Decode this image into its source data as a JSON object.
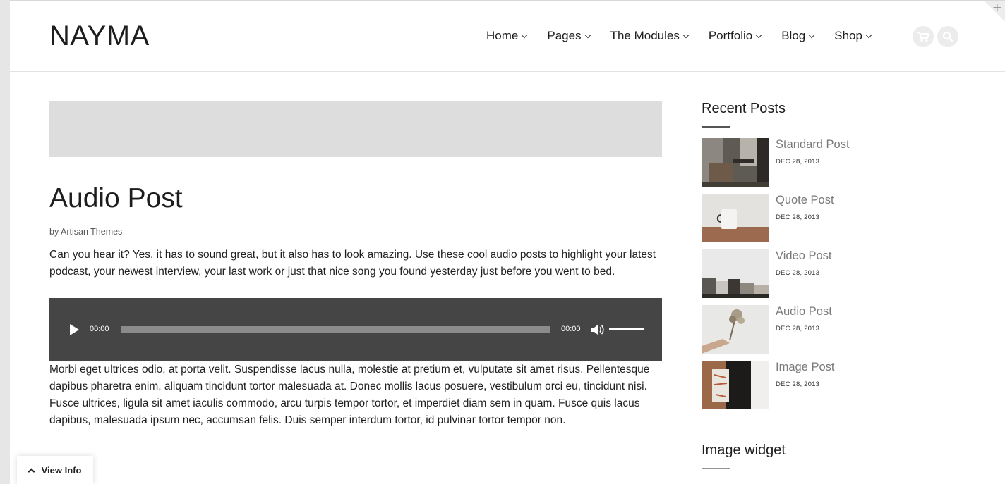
{
  "header": {
    "logo": "NAYMA",
    "nav": [
      {
        "label": "Home"
      },
      {
        "label": "Pages"
      },
      {
        "label": "The Modules"
      },
      {
        "label": "Portfolio"
      },
      {
        "label": "Blog"
      },
      {
        "label": "Shop"
      }
    ],
    "icons": [
      "cart-icon",
      "search-icon"
    ]
  },
  "post": {
    "title": "Audio Post",
    "byline_prefix": "by",
    "author": "Artisan Themes",
    "intro": "Can you hear it? Yes, it has to sound great, but it also has to look amazing. Use these cool audio posts to highlight your latest podcast, your newest interview, your last work or just that nice song you found yesterday just before you went to bed.",
    "player": {
      "current_time": "00:00",
      "duration": "00:00",
      "progress": 0,
      "volume": 1.0
    },
    "body": "Morbi eget ultrices odio, at porta velit. Suspendisse lacus nulla, molestie at pretium et, vulputate sit amet risus. Pellentesque dapibus pharetra enim, aliquam tincidunt tortor malesuada at. Donec mollis lacus posuere, vestibulum orci eu, tincidunt nisi. Fusce ultrices, ligula sit amet iaculis commodo, arcu turpis tempor tortor, et imperdiet diam sem in quam. Fusce quis lacus dapibus, malesuada ipsum nec, accumsan felis. Duis semper interdum tortor, id pulvinar tortor tempor non."
  },
  "sidebar": {
    "recent_title": "Recent Posts",
    "recent": [
      {
        "title": "Standard Post",
        "date": "DEC 28, 2013"
      },
      {
        "title": "Quote Post",
        "date": "DEC 28, 2013"
      },
      {
        "title": "Video Post",
        "date": "DEC 28, 2013"
      },
      {
        "title": "Audio Post",
        "date": "DEC 28, 2013"
      },
      {
        "title": "Image Post",
        "date": "DEC 28, 2013"
      }
    ],
    "image_widget_title": "Image widget"
  },
  "footer": {
    "view_info": "View Info"
  },
  "colors": {
    "player_bg": "#454545",
    "banner_bg": "#dcdddc",
    "meta_gray": "#7a7a7a"
  }
}
